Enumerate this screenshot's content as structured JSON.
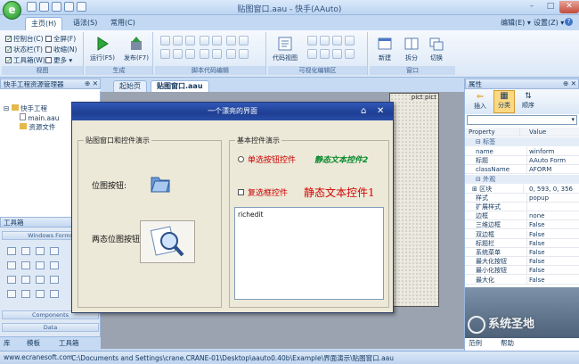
{
  "window": {
    "title": "贴图窗口.aau - 快手(AAuto)",
    "min": "–",
    "max": "□",
    "close": "✕"
  },
  "menu": {
    "tabs": [
      "主页(H)",
      "语法(S)",
      "常用(C)"
    ],
    "right": [
      "编辑(E) ▾",
      "设置(Z) ▾"
    ]
  },
  "ribbon": {
    "view_group": {
      "label": "视图",
      "checks": [
        {
          "label": "控制台(C)",
          "checked": true
        },
        {
          "label": "状态栏(T)",
          "checked": true
        },
        {
          "label": "工具箱(W)",
          "checked": true
        },
        {
          "label": "全屏(F)",
          "checked": false
        },
        {
          "label": "收缩(N)",
          "checked": false
        },
        {
          "label": "更多 ▾",
          "checked": false
        }
      ]
    },
    "build_group": {
      "label": "生成",
      "run": "运行(F5)",
      "publish": "发布(F7)"
    },
    "script_group": {
      "label": "脚本代码编辑"
    },
    "visual_group": {
      "label": "可视化编辑区",
      "code_view": "代码视图"
    },
    "window_group": {
      "label": "窗口",
      "new": "新建",
      "split": "拆分",
      "switch": "切换"
    }
  },
  "left_panel": {
    "title": "快手工程资源管理器",
    "tree": [
      "快手工程",
      "main.aau",
      "资源文件"
    ]
  },
  "toolbox": {
    "title": "工具箱",
    "sections": [
      "Windows Forms",
      "Components",
      "Data"
    ]
  },
  "bottom_tabs": [
    "库",
    "模板",
    "工具箱"
  ],
  "doc_tabs": [
    "起始页",
    "贴图窗口.aau"
  ],
  "design_label": "pict pict",
  "form": {
    "title": "一个漂亮的界面",
    "group_left": "贴图窗口和控件演示",
    "bitmap_button": "位图按钮:",
    "two_state_button": "两态位图按钮:",
    "group_right": "基本控件演示",
    "radio": "单选按钮控件",
    "static_green": "静态文本控件2",
    "checkbox": "复选框控件",
    "static_red": "静态文本控件1",
    "richedit": "richedit"
  },
  "properties": {
    "title": "属性",
    "buttons": [
      "插入",
      "分类",
      "顺序"
    ],
    "header": [
      "Property",
      "Value"
    ],
    "cat1": "标签",
    "rows1": [
      [
        "name",
        "winform"
      ],
      [
        "标题",
        "AAuto Form"
      ],
      [
        "className",
        "AFORM"
      ]
    ],
    "cat2": "外观",
    "rows2": [
      [
        "区块",
        "0, 593, 0, 356"
      ],
      [
        "样式",
        "popup"
      ],
      [
        "扩展样式",
        ""
      ],
      [
        "边框",
        "none"
      ],
      [
        "三维边框",
        "False"
      ],
      [
        "双边框",
        "False"
      ],
      [
        "标题栏",
        "False"
      ],
      [
        "系统菜单",
        "False"
      ],
      [
        "最大化按钮",
        "False"
      ],
      [
        "最小化按钮",
        "False"
      ],
      [
        "最大化",
        "False"
      ]
    ],
    "bottom": [
      "范例",
      "帮助"
    ]
  },
  "status": {
    "left": "www.ecranesoft.com",
    "path": "C:\\Documents and Settings\\crane.CRANE-01\\Desktop\\aauto0.40b\\Example\\界面演示\\贴图窗口.aau"
  },
  "watermark": "系统圣地"
}
